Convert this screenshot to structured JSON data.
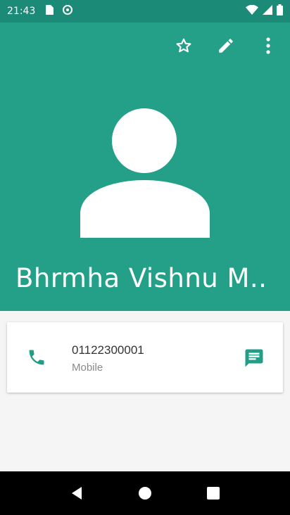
{
  "status_bar": {
    "time": "21:43"
  },
  "icons": {
    "star": "star-outline-icon",
    "edit": "pencil-icon",
    "more": "more-vert-icon",
    "phone": "phone-icon",
    "message": "message-icon",
    "nav_back": "back-triangle-icon",
    "nav_home": "home-circle-icon",
    "nav_recents": "recents-square-icon"
  },
  "contact": {
    "name": "Bhrmha Vishnu M...",
    "phones": [
      {
        "number": "01122300001",
        "type": "Mobile"
      }
    ]
  },
  "colors": {
    "header": "#23a087",
    "status_bar": "#1b8a76",
    "accent": "#239d85"
  }
}
